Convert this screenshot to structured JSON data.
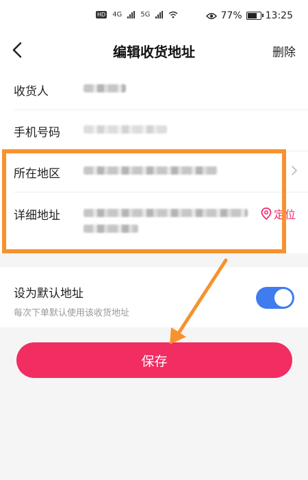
{
  "status_bar": {
    "network_badge": "HD",
    "net_4g": "4G",
    "net_5g": "5G",
    "battery_percent": "77%",
    "battery_level": 0.77,
    "time": "13:25"
  },
  "header": {
    "title": "编辑收货地址",
    "delete_label": "删除"
  },
  "form": {
    "fields": [
      {
        "label": "收货人"
      },
      {
        "label": "手机号码"
      },
      {
        "label": "所在地区"
      },
      {
        "label": "详细地址"
      }
    ],
    "locate_label": "定位"
  },
  "default_address": {
    "title": "设为默认地址",
    "subtitle": "每次下单默认使用该收货地址",
    "enabled": true
  },
  "save_label": "保存",
  "colors": {
    "accent": "#f12d62",
    "toggle_on": "#3f7cf0",
    "annotation": "#f7922e",
    "locate": "#ee2d6b"
  }
}
